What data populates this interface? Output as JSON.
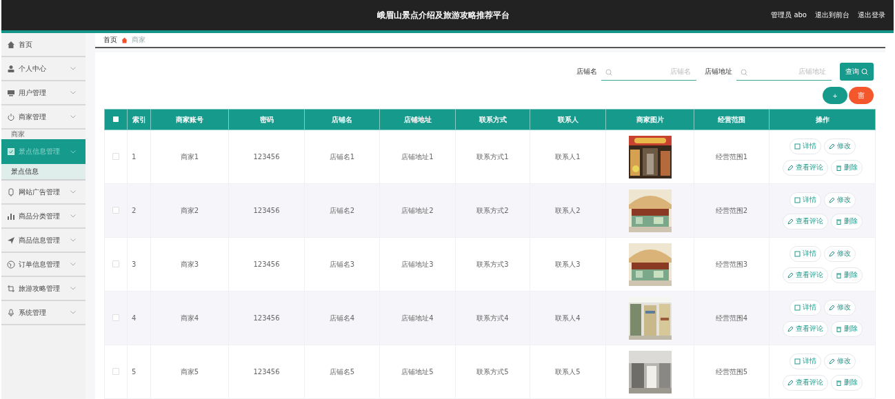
{
  "header": {
    "title": "峨眉山景点介绍及旅游攻略推荐平台",
    "user": "管理员 abo",
    "links": [
      "退出到前台",
      "退出登录"
    ]
  },
  "sidebar": {
    "items": [
      {
        "label": "首页",
        "kind": "link",
        "selected": false
      },
      {
        "label": "个人中心",
        "kind": "menu",
        "selected": false
      },
      {
        "label": "用户管理",
        "kind": "menu",
        "selected": false
      },
      {
        "label": "商家管理",
        "kind": "menu",
        "selected": false,
        "children": [
          {
            "label": "商家",
            "selected": false
          }
        ]
      },
      {
        "label": "景点信息管理",
        "kind": "menu",
        "selected": true,
        "children": [
          {
            "label": "景点信息",
            "selected": false
          }
        ]
      },
      {
        "label": "网站广告管理",
        "kind": "menu",
        "selected": false
      },
      {
        "label": "商品分类管理",
        "kind": "menu",
        "selected": false
      },
      {
        "label": "商品信息管理",
        "kind": "menu",
        "selected": false
      },
      {
        "label": "订单信息管理",
        "kind": "menu",
        "selected": false
      },
      {
        "label": "旅游攻略管理",
        "kind": "menu",
        "selected": false
      },
      {
        "label": "系统管理",
        "kind": "menu",
        "selected": false
      }
    ]
  },
  "breadcrumb": [
    "首页",
    "商家"
  ],
  "search": {
    "fields": [
      {
        "label": "店铺名",
        "placeholder": "店铺名"
      },
      {
        "label": "店铺地址",
        "placeholder": "店铺地址"
      }
    ],
    "button": "查询"
  },
  "actions": [
    {
      "kind": "add",
      "label": "+"
    },
    {
      "kind": "delete",
      "label": "亩"
    }
  ],
  "table": {
    "all_checked": false,
    "columns": [
      "索引",
      "商家账号",
      "密码",
      "店铺名",
      "店铺地址",
      "联系方式",
      "联系人",
      "商家图片",
      "经营范围",
      "操作"
    ],
    "rows": [
      {
        "checked": false,
        "cells": [
          "1",
          "商家1",
          "123456",
          "店铺名1",
          "店铺地址1",
          "联系方式1",
          "联系人1"
        ],
        "image": {
          "kind": "picture"
        },
        "scope": "经营范围1",
        "actions": [
          "详情",
          "修改",
          "查看评论",
          "删除"
        ]
      },
      {
        "checked": false,
        "cells": [
          "2",
          "商家2",
          "123456",
          "店铺名2",
          "店铺地址2",
          "联系方式2",
          "联系人2"
        ],
        "image": {
          "kind": "picture"
        },
        "scope": "经营范围2",
        "actions": [
          "详情",
          "修改",
          "查看评论",
          "删除"
        ]
      },
      {
        "checked": false,
        "cells": [
          "3",
          "商家3",
          "123456",
          "店铺名3",
          "店铺地址3",
          "联系方式3",
          "联系人3"
        ],
        "image": {
          "kind": "picture"
        },
        "scope": "经营范围3",
        "actions": [
          "详情",
          "修改",
          "查看评论",
          "删除"
        ]
      },
      {
        "checked": false,
        "cells": [
          "4",
          "商家4",
          "123456",
          "店铺名4",
          "店铺地址4",
          "联系方式4",
          "联系人4"
        ],
        "image": {
          "kind": "picture"
        },
        "scope": "经营范围4",
        "actions": [
          "详情",
          "修改",
          "查看评论",
          "删除"
        ]
      },
      {
        "checked": false,
        "cells": [
          "5",
          "商家5",
          "123456",
          "店铺名5",
          "店铺地址5",
          "联系方式5",
          "联系人5"
        ],
        "image": {
          "kind": "picture"
        },
        "scope": "经营范围5",
        "actions": [
          "详情",
          "修改",
          "查看评论",
          "删除"
        ]
      }
    ]
  }
}
